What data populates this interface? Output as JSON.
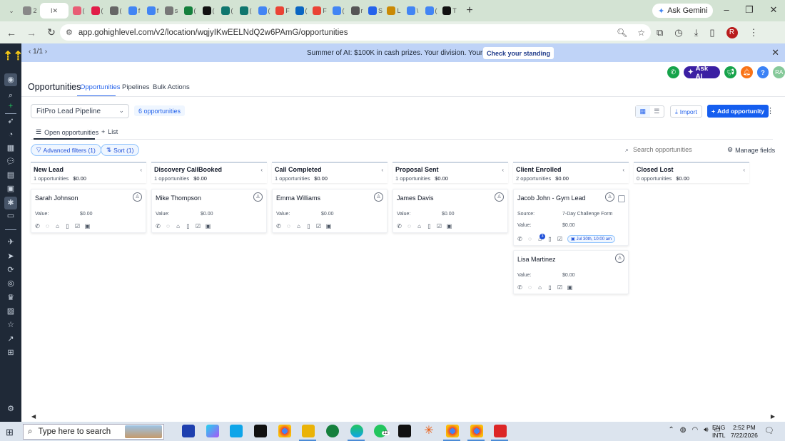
{
  "browser": {
    "tabs": [
      {
        "label": "2",
        "color": "#888"
      },
      {
        "label": "(",
        "color": "#e85d75"
      },
      {
        "label": "(",
        "color": "#e11d48"
      },
      {
        "label": "(",
        "color": "#666"
      },
      {
        "label": "f",
        "color": "#4285f4"
      },
      {
        "label": "f",
        "color": "#4285f4"
      },
      {
        "label": "s",
        "color": "#777"
      },
      {
        "label": "(",
        "color": "#15803d"
      },
      {
        "label": "(",
        "color": "#111"
      },
      {
        "label": "(",
        "color": "#0f766e"
      },
      {
        "label": "(",
        "color": "#0f766e"
      },
      {
        "label": "(",
        "color": "#4285f4"
      },
      {
        "label": "F",
        "color": "#ea4335"
      },
      {
        "label": "(",
        "color": "#0a66c2"
      },
      {
        "label": "F",
        "color": "#ea4335"
      },
      {
        "label": "(",
        "color": "#4285f4"
      },
      {
        "label": "r",
        "color": "#555"
      },
      {
        "label": "S",
        "color": "#2563eb"
      },
      {
        "label": "L",
        "color": "#ca8a04"
      },
      {
        "label": "\\",
        "color": "#4285f4"
      },
      {
        "label": "(",
        "color": "#4285f4"
      },
      {
        "label": "T",
        "color": "#111"
      }
    ],
    "active_tab_label": "I",
    "ask_gemini": "Ask Gemini",
    "url": "app.gohighlevel.com/v2/location/wqjyIKwEELNdQ2w6PAmG/opportunities",
    "profile_initial": "R"
  },
  "banner": {
    "pager": "1/1",
    "message": "Summer of AI: $100K in cash prizes. Your division. Your clients.",
    "cta": "Check your standing"
  },
  "header": {
    "ask_ai": "Ask AI",
    "user_initials": "RA",
    "title": "Opportunities",
    "tabs": [
      "Opportunities",
      "Pipelines",
      "Bulk Actions"
    ]
  },
  "toolbar": {
    "pipeline": "FitPro Lead Pipeline",
    "count": "6 opportunities",
    "import": "Import",
    "add": "Add opportunity"
  },
  "subtabs": {
    "open": "Open opportunities",
    "list": "List"
  },
  "filters": {
    "advanced": "Advanced filters (1)",
    "sort": "Sort (1)",
    "search_placeholder": "Search opportunities",
    "manage_fields": "Manage fields"
  },
  "columns": [
    {
      "name": "New Lead",
      "count": "1 opportunities",
      "total": "$0.00"
    },
    {
      "name": "Discovery CallBooked",
      "count": "1 opportunities",
      "total": "$0.00"
    },
    {
      "name": "Call Completed",
      "count": "1 opportunities",
      "total": "$0.00"
    },
    {
      "name": "Proposal Sent",
      "count": "1 opportunities",
      "total": "$0.00"
    },
    {
      "name": "Client Enrolled",
      "count": "2 opportunities",
      "total": "$0.00"
    },
    {
      "name": "Closed Lost",
      "count": "0 opportunities",
      "total": "$0.00"
    }
  ],
  "cards": {
    "c1": {
      "name": "Sarah Johnson",
      "value_label": "Value:",
      "value": "$0.00"
    },
    "c2": {
      "name": "Mike Thompson",
      "value_label": "Value:",
      "value": "$0.00"
    },
    "c3": {
      "name": "Emma Williams",
      "value_label": "Value:",
      "value": "$0.00"
    },
    "c4": {
      "name": "James Davis",
      "value_label": "Value:",
      "value": "$0.00"
    },
    "c5": {
      "name": "Jacob John - Gym Lead",
      "source_label": "Source:",
      "source": "7-Day Challenge Form",
      "value_label": "Value:",
      "value": "$0.00",
      "badge": "3",
      "appointment": "Jul 30th, 10:00 am"
    },
    "c6": {
      "name": "Lisa Martinez",
      "value_label": "Value:",
      "value": "$0.00"
    }
  },
  "taskbar": {
    "search_placeholder": "Type here to search",
    "whatsapp_badge": "12",
    "lang": "ENG",
    "region": "INTL",
    "time": "2:52 PM",
    "date": "7/22/2026"
  }
}
